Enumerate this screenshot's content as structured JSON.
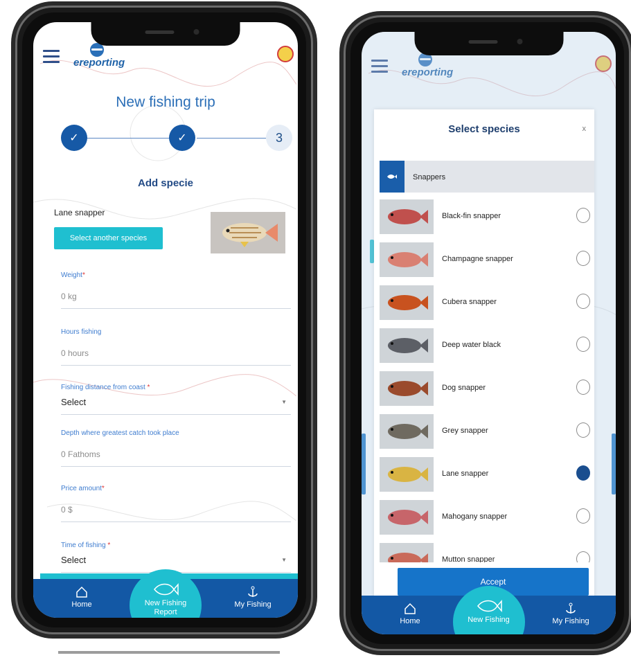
{
  "app": {
    "logo_text": "ereporting"
  },
  "left": {
    "title": "New fishing trip",
    "steps": [
      "✓",
      "✓",
      "3"
    ],
    "subheading": "Add specie",
    "selected_species": "Lane snapper",
    "select_button": "Select another species",
    "fields": [
      {
        "label": "Weight",
        "required": "*",
        "value": "0  kg"
      },
      {
        "label": "Hours fishing",
        "required": "",
        "value": "0 hours"
      },
      {
        "label": "Fishing distance from coast",
        "required": " *",
        "value": "Select"
      },
      {
        "label": "Depth where greatest catch took place",
        "required": "",
        "value": "0 Fathoms"
      },
      {
        "label": "Price amount",
        "required": "*",
        "value": "0 $"
      },
      {
        "label": "Time of fishing",
        "required": " *",
        "value": "Select"
      }
    ]
  },
  "nav": {
    "home": "Home",
    "new_fishing": "New Fishing Report",
    "new_fishing_short": "New Fishing",
    "my_fishing": "My Fishing"
  },
  "modal": {
    "title": "Select species",
    "close": "x",
    "group": "Snappers",
    "items": [
      {
        "name": "Black-fin snapper",
        "selected": false,
        "color": "#c0504d"
      },
      {
        "name": "Champagne snapper",
        "selected": false,
        "color": "#d98072"
      },
      {
        "name": "Cubera snapper",
        "selected": false,
        "color": "#c8521f"
      },
      {
        "name": "Deep water black",
        "selected": false,
        "color": "#5c5f66"
      },
      {
        "name": "Dog snapper",
        "selected": false,
        "color": "#9a4a2c"
      },
      {
        "name": "Grey snapper",
        "selected": false,
        "color": "#6f6a60"
      },
      {
        "name": "Lane snapper",
        "selected": true,
        "color": "#d9b443"
      },
      {
        "name": "Mahogany snapper",
        "selected": false,
        "color": "#c7656a"
      },
      {
        "name": "Mutton snapper",
        "selected": false,
        "color": "#c96a5a"
      }
    ],
    "accept": "Accept"
  },
  "colors": {
    "primary": "#1358a5",
    "accent": "#1fbfd0",
    "title": "#2c6fb7"
  }
}
